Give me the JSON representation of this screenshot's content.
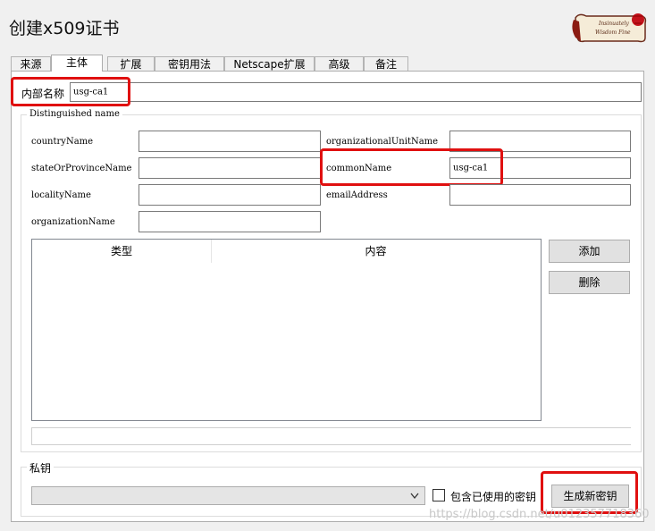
{
  "window": {
    "title": "创建x509证书"
  },
  "logo": {
    "icon": "scroll-seal-logo-icon",
    "text_line1": "Insinuately",
    "text_line2": "Wisdom Fine"
  },
  "tabs": [
    {
      "label": "来源"
    },
    {
      "label": "主体"
    },
    {
      "label": "扩展"
    },
    {
      "label": "密钥用法"
    },
    {
      "label": "Netscape扩展"
    },
    {
      "label": "高级"
    },
    {
      "label": "备注"
    }
  ],
  "active_tab": "主体",
  "internal_name": {
    "label": "内部名称",
    "value": "usg-ca1"
  },
  "dn": {
    "legend": "Distinguished name",
    "fields": {
      "countryName": {
        "label": "countryName",
        "value": ""
      },
      "stateOrProvinceName": {
        "label": "stateOrProvinceName",
        "value": ""
      },
      "localityName": {
        "label": "localityName",
        "value": ""
      },
      "organizationName": {
        "label": "organizationName",
        "value": ""
      },
      "organizationalUnitName": {
        "label": "organizationalUnitName",
        "value": ""
      },
      "commonName": {
        "label": "commonName",
        "value": "usg-ca1"
      },
      "emailAddress": {
        "label": "emailAddress",
        "value": ""
      }
    },
    "table": {
      "columns": [
        "类型",
        "内容"
      ],
      "rows": []
    },
    "add_label": "添加",
    "delete_label": "删除"
  },
  "private_key": {
    "legend": "私钥",
    "selected": "",
    "include_used_label": "包含已使用的密钥",
    "include_used_checked": false,
    "generate_label": "生成新密钥"
  },
  "watermark": "https://blog.csdn.net/u012357718360",
  "colors": {
    "highlight": "#e01010",
    "panel": "#ffffff",
    "window": "#f0f0f0"
  }
}
